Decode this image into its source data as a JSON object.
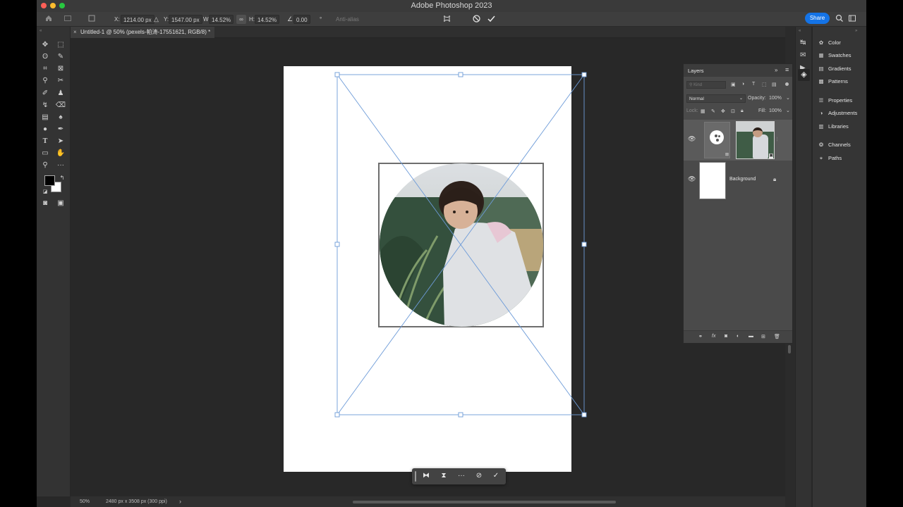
{
  "app": {
    "title": "Adobe Photoshop 2023"
  },
  "options_bar": {
    "x_label": "X:",
    "x_value": "1214.00 px",
    "y_label": "Y:",
    "y_value": "1547.00 px",
    "w_label": "W:",
    "w_value": "14.52%",
    "h_label": "H:",
    "h_value": "14.52%",
    "angle_value": "0.00",
    "angle_unit": "°",
    "antialias_label": "Anti-alias",
    "share_label": "Share"
  },
  "document_tab": {
    "title": "Untitled-1 @ 50% (pexels-帕涛-17551621, RGB/8) *"
  },
  "context_bar": {
    "items": [
      "flip-horizontal",
      "flip-vertical",
      "more",
      "cancel",
      "commit"
    ]
  },
  "status_bar": {
    "zoom": "50%",
    "doc_size": "2480 px x 3508 px (300 ppi)",
    "arrow": "›"
  },
  "layers_panel": {
    "title": "Layers",
    "search_placeholder": "Kind",
    "blend_mode": "Normal",
    "opacity_label": "Opacity:",
    "opacity_value": "100%",
    "lock_label": "Lock:",
    "fill_label": "Fill:",
    "fill_value": "100%",
    "layers": [
      {
        "name": "",
        "type": "smart-object-with-mask",
        "visible": true
      },
      {
        "name": "Background",
        "type": "background",
        "visible": true,
        "locked": true
      }
    ]
  },
  "right_panel": {
    "items": [
      "Color",
      "Swatches",
      "Gradients",
      "Patterns",
      "Properties",
      "Adjustments",
      "Libraries",
      "Channels",
      "Paths"
    ],
    "icons": [
      "palette-icon",
      "grid-icon",
      "gradient-icon",
      "pattern-icon",
      "properties-icon",
      "adjustments-icon",
      "libraries-icon",
      "channels-icon",
      "paths-icon"
    ]
  },
  "colors": {
    "accent": "#1473e6",
    "transform_box": "#6d9bd8",
    "canvas": "#282828",
    "panel": "#4a4a4a"
  }
}
